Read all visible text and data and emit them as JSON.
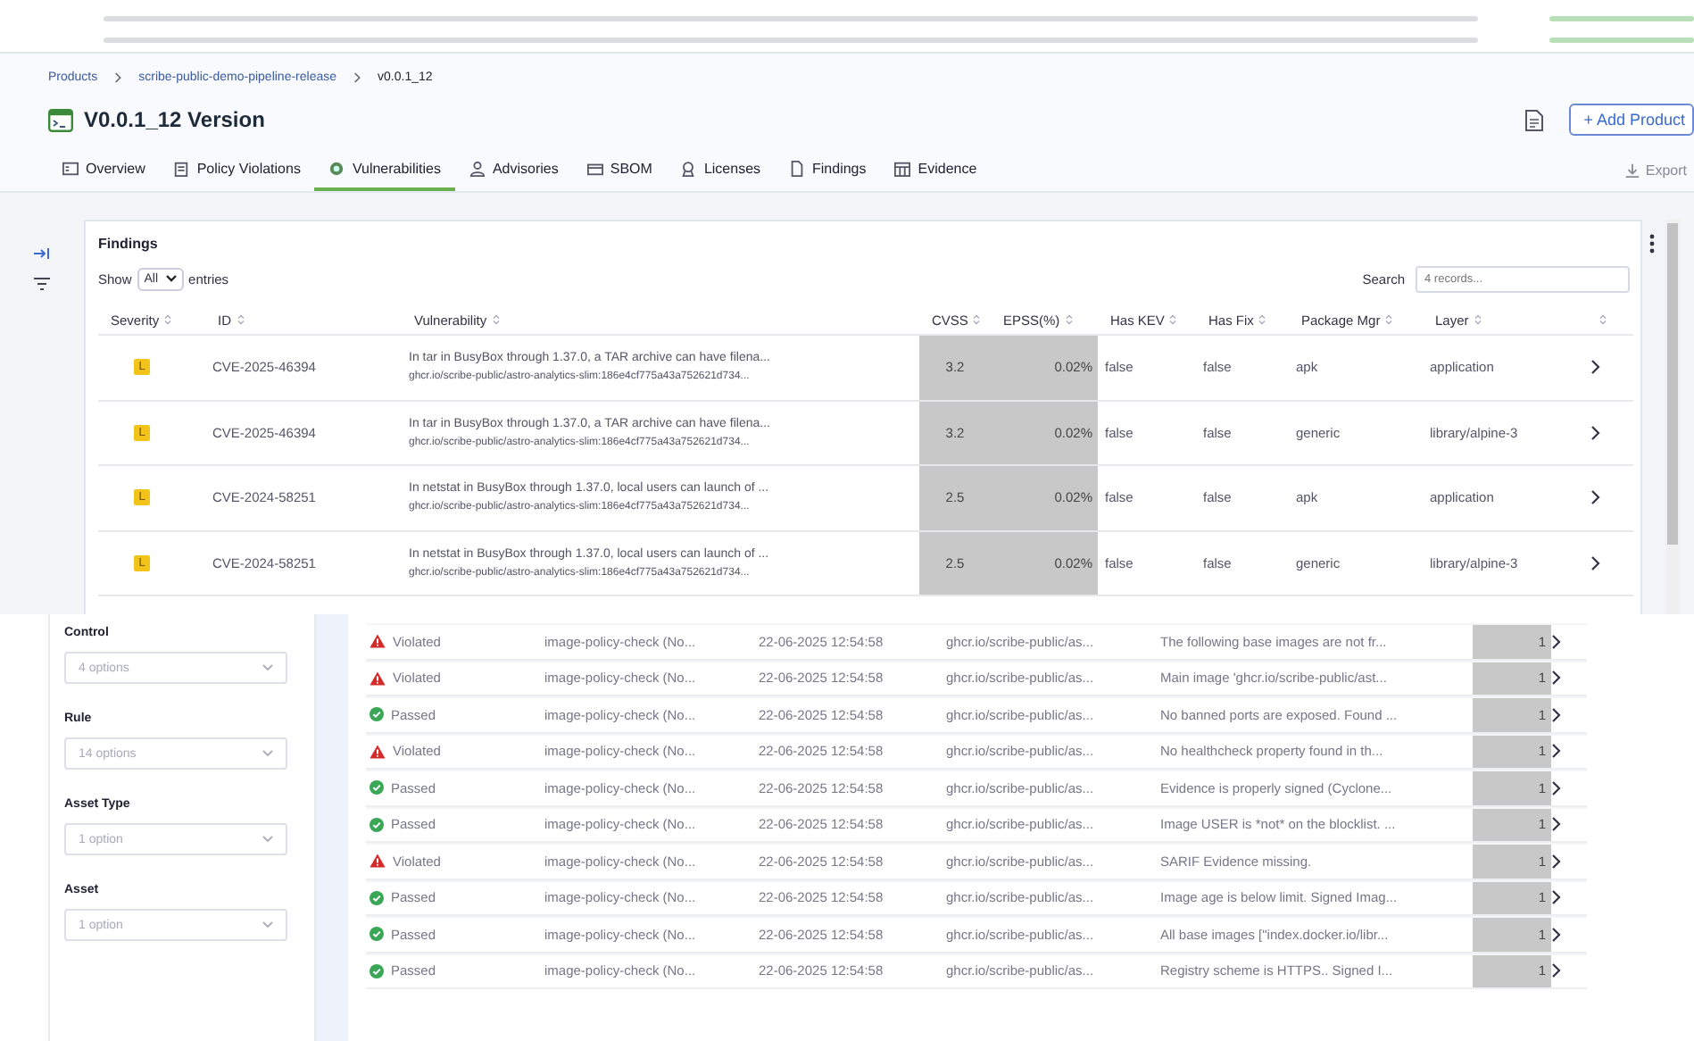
{
  "breadcrumb": [
    "Products",
    "scribe-public-demo-pipeline-release",
    "v0.0.1_12"
  ],
  "title": "V0.0.1_12 Version",
  "add_button": "+ Add Product",
  "tabs": [
    {
      "label": "Overview",
      "selected": false
    },
    {
      "label": "Policy Violations",
      "selected": false
    },
    {
      "label": "Vulnerabilities",
      "selected": true
    },
    {
      "label": "Advisories",
      "selected": false
    },
    {
      "label": "SBOM",
      "selected": false
    },
    {
      "label": "Licenses",
      "selected": false
    },
    {
      "label": "Findings",
      "selected": false
    },
    {
      "label": "Evidence",
      "selected": false
    }
  ],
  "export": "Export",
  "findings": {
    "title": "Findings",
    "show_label": "Show",
    "page_size": "All",
    "entries_label": "entries",
    "search_label": "Search",
    "search_placeholder": "4 records...",
    "columns": [
      "Severity",
      "ID",
      "Vulnerability",
      "CVSS",
      "EPSS(%)",
      "Has KEV",
      "Has Fix",
      "Package Mgr",
      "Layer"
    ],
    "rows": [
      {
        "severity": "L",
        "id": "CVE-2025-46394",
        "vulnerability": "In tar in BusyBox through 1.37.0, a TAR archive can have filena...",
        "image": "ghcr.io/scribe-public/astro-analytics-slim:186e4cf775a43a752621d734...",
        "cvss": "3.2",
        "epss": "0.02%",
        "has_kev": "false",
        "has_fix": "false",
        "package_mgr": "apk",
        "layer": "application"
      },
      {
        "severity": "L",
        "id": "CVE-2025-46394",
        "vulnerability": "In tar in BusyBox through 1.37.0, a TAR archive can have filena...",
        "image": "ghcr.io/scribe-public/astro-analytics-slim:186e4cf775a43a752621d734...",
        "cvss": "3.2",
        "epss": "0.02%",
        "has_kev": "false",
        "has_fix": "false",
        "package_mgr": "generic",
        "layer": "library/alpine-3"
      },
      {
        "severity": "L",
        "id": "CVE-2024-58251",
        "vulnerability": "In netstat in BusyBox through 1.37.0, local users can launch of ...",
        "image": "ghcr.io/scribe-public/astro-analytics-slim:186e4cf775a43a752621d734...",
        "cvss": "2.5",
        "epss": "0.02%",
        "has_kev": "false",
        "has_fix": "false",
        "package_mgr": "apk",
        "layer": "application"
      },
      {
        "severity": "L",
        "id": "CVE-2024-58251",
        "vulnerability": "In netstat in BusyBox through 1.37.0, local users can launch of ...",
        "image": "ghcr.io/scribe-public/astro-analytics-slim:186e4cf775a43a752621d734...",
        "cvss": "2.5",
        "epss": "0.02%",
        "has_kev": "false",
        "has_fix": "false",
        "package_mgr": "generic",
        "layer": "library/alpine-3"
      }
    ]
  },
  "filters": [
    {
      "label": "Control",
      "placeholder": "4 options"
    },
    {
      "label": "Rule",
      "placeholder": "14 options"
    },
    {
      "label": "Asset Type",
      "placeholder": "1 option"
    },
    {
      "label": "Asset",
      "placeholder": "1 option"
    }
  ],
  "checks": [
    {
      "kind": "violated",
      "status": "Violated",
      "rule": "image-policy-check (No...",
      "date": "22-06-2025 12:54:58",
      "asset": "ghcr.io/scribe-public/as...",
      "message": "The following base images are not fr...",
      "count": "1"
    },
    {
      "kind": "violated",
      "status": "Violated",
      "rule": "image-policy-check (No...",
      "date": "22-06-2025 12:54:58",
      "asset": "ghcr.io/scribe-public/as...",
      "message": "Main image 'ghcr.io/scribe-public/ast...",
      "count": "1"
    },
    {
      "kind": "passed",
      "status": "Passed",
      "rule": "image-policy-check (No...",
      "date": "22-06-2025 12:54:58",
      "asset": "ghcr.io/scribe-public/as...",
      "message": "No banned ports are exposed. Found ...",
      "count": "1"
    },
    {
      "kind": "violated",
      "status": "Violated",
      "rule": "image-policy-check (No...",
      "date": "22-06-2025 12:54:58",
      "asset": "ghcr.io/scribe-public/as...",
      "message": "No healthcheck property found in th...",
      "count": "1"
    },
    {
      "kind": "passed",
      "status": "Passed",
      "rule": "image-policy-check (No...",
      "date": "22-06-2025 12:54:58",
      "asset": "ghcr.io/scribe-public/as...",
      "message": "Evidence is properly signed (Cyclone...",
      "count": "1"
    },
    {
      "kind": "passed",
      "status": "Passed",
      "rule": "image-policy-check (No...",
      "date": "22-06-2025 12:54:58",
      "asset": "ghcr.io/scribe-public/as...",
      "message": "Image USER is *not* on the blocklist. ...",
      "count": "1"
    },
    {
      "kind": "violated",
      "status": "Violated",
      "rule": "image-policy-check (No...",
      "date": "22-06-2025 12:54:58",
      "asset": "ghcr.io/scribe-public/as...",
      "message": "SARIF Evidence missing.",
      "count": "1"
    },
    {
      "kind": "passed",
      "status": "Passed",
      "rule": "image-policy-check (No...",
      "date": "22-06-2025 12:54:58",
      "asset": "ghcr.io/scribe-public/as...",
      "message": "Image age is below limit. Signed Imag...",
      "count": "1"
    },
    {
      "kind": "passed",
      "status": "Passed",
      "rule": "image-policy-check (No...",
      "date": "22-06-2025 12:54:58",
      "asset": "ghcr.io/scribe-public/as...",
      "message": "All base images [\"index.docker.io/libr...",
      "count": "1"
    },
    {
      "kind": "passed",
      "status": "Passed",
      "rule": "image-policy-check (No...",
      "date": "22-06-2025 12:54:58",
      "asset": "ghcr.io/scribe-public/as...",
      "message": "Registry scheme is HTTPS.. Signed I...",
      "count": "1"
    }
  ]
}
